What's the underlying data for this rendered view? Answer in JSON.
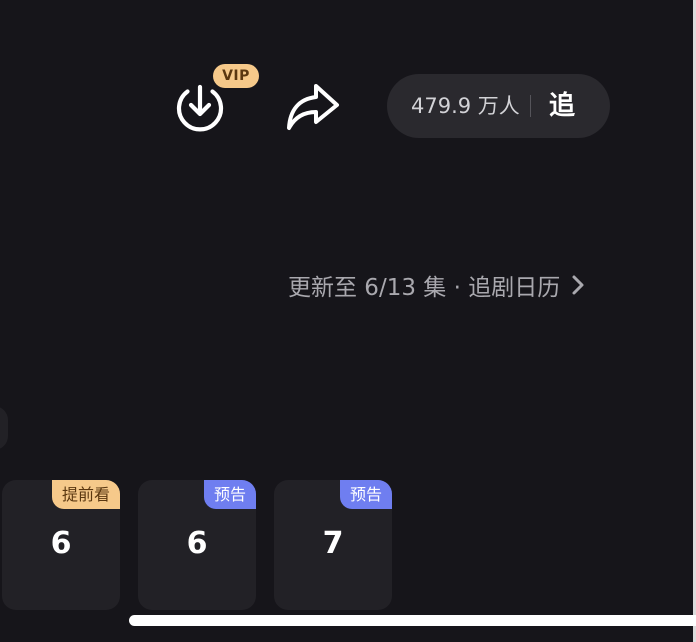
{
  "header": {
    "download": {
      "icon": "download-icon",
      "badge": "VIP"
    },
    "share": {
      "icon": "share-icon"
    },
    "follow": {
      "count": "479.9 万人",
      "label": "追"
    }
  },
  "update": {
    "text": "更新至 6/13 集 · 追剧日历",
    "chevron_icon": "chevron-right-icon"
  },
  "episodes": [
    {
      "number": "6",
      "badge": "提前看",
      "badge_color": "#f6c98a"
    },
    {
      "number": "6",
      "badge": "预告",
      "badge_color": "#6f7ef0"
    },
    {
      "number": "7",
      "badge": "预告",
      "badge_color": "#6f7ef0"
    }
  ],
  "colors": {
    "background": "#16151a",
    "card": "#222126",
    "vip_gold": "#f6c98a",
    "preview_blue": "#6f7ef0"
  }
}
